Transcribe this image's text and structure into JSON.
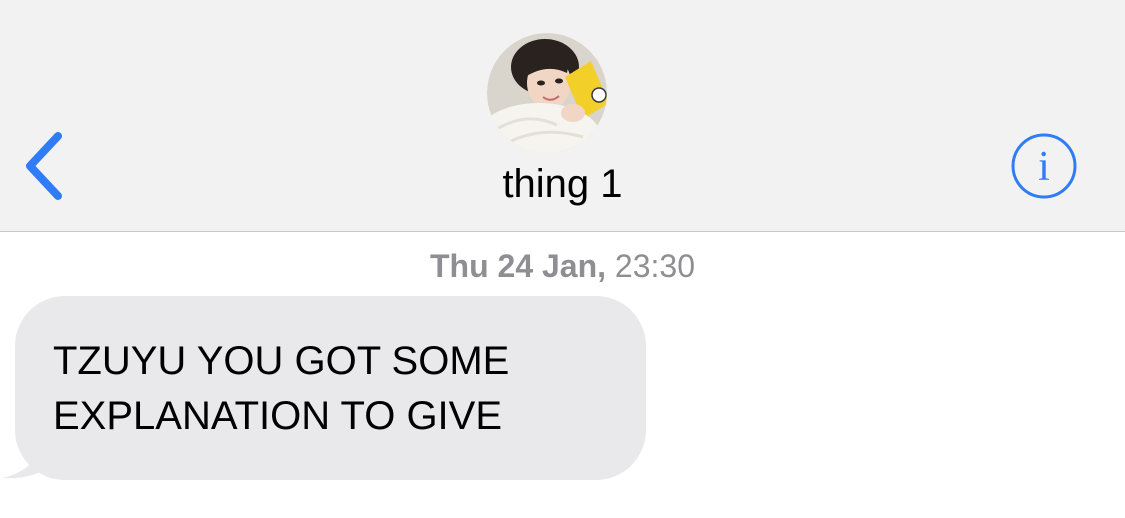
{
  "header": {
    "contact_name": "thing 1",
    "back_icon": "chevron-left-icon",
    "info_icon": "info-circle-icon",
    "accent_color": "#2f7cf6",
    "background_color": "#f2f2f2"
  },
  "conversation": {
    "timestamp_day": "Thu 24 Jan,",
    "timestamp_time": "23:30",
    "messages": [
      {
        "direction": "incoming",
        "text": "TZUYU YOU GOT SOME\nEXPLANATION TO GIVE",
        "bubble_color": "#e9e9eb"
      }
    ]
  }
}
